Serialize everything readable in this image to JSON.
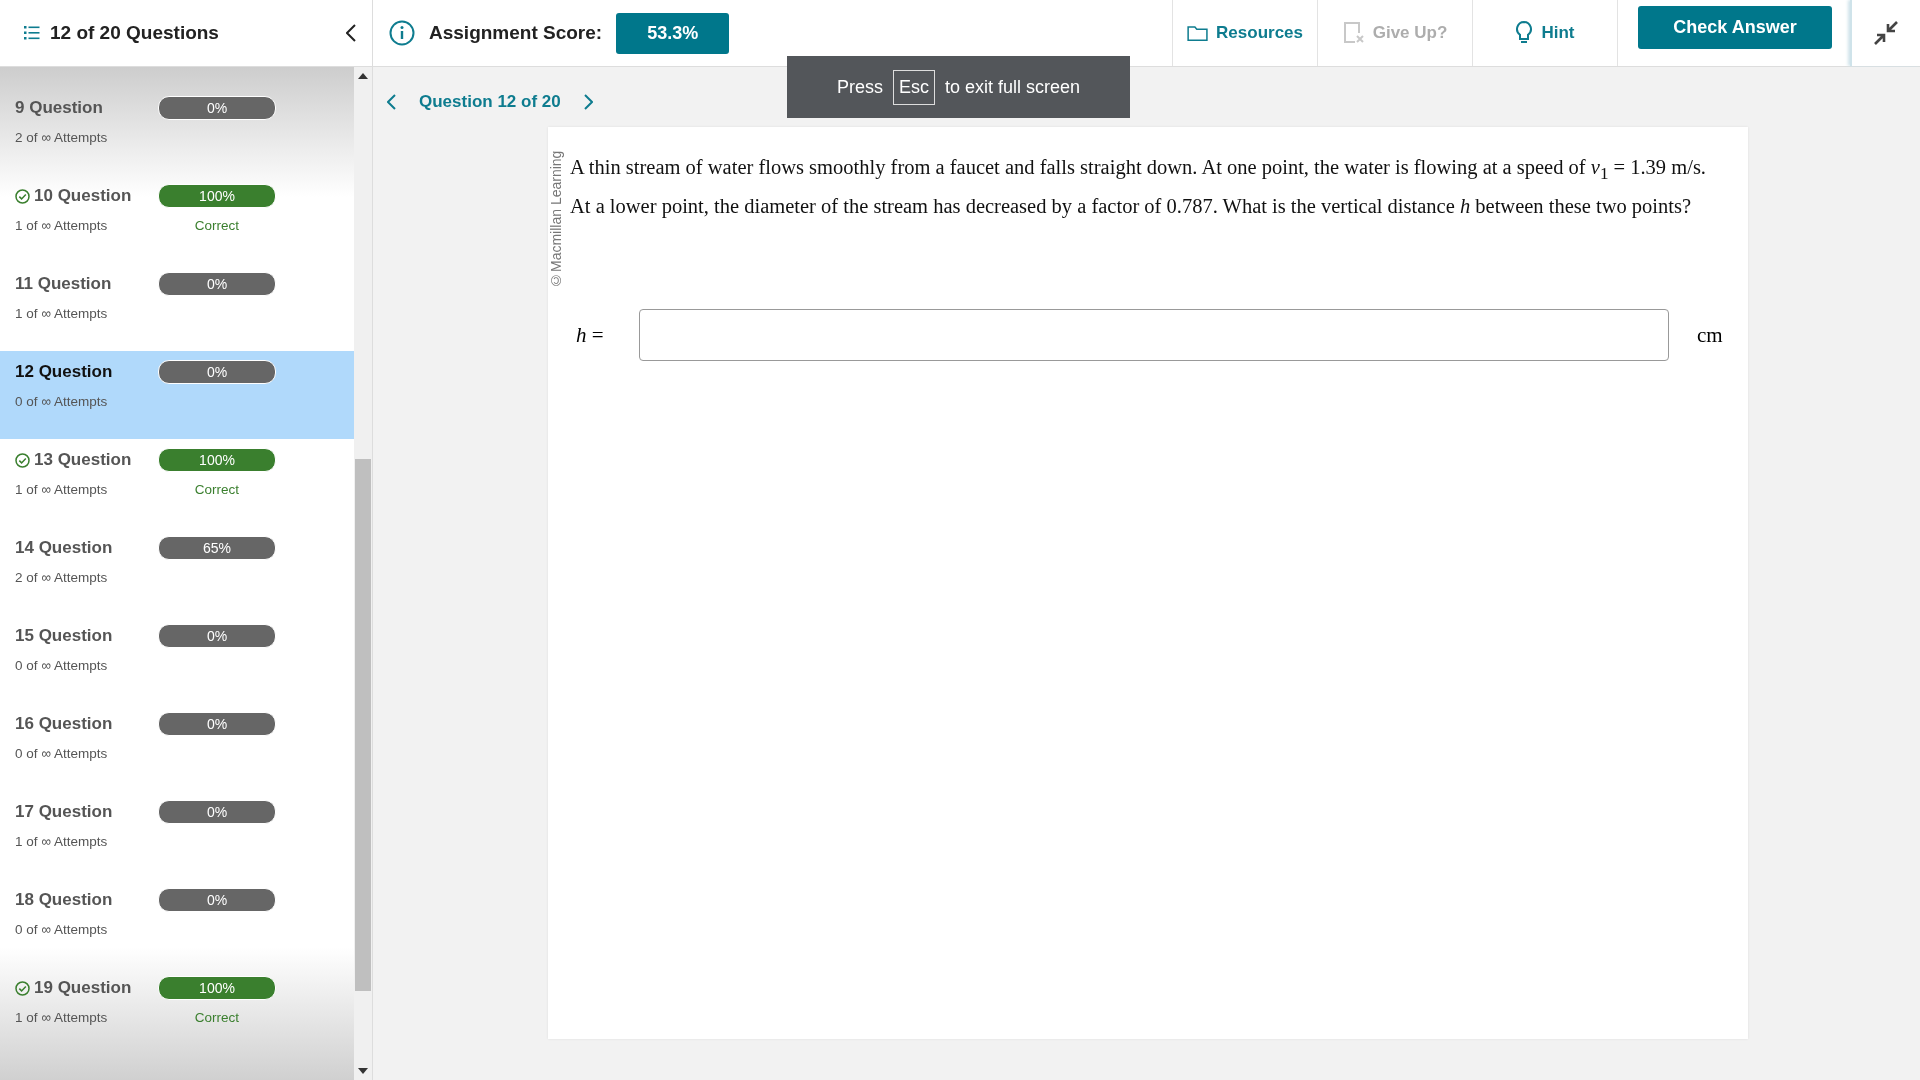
{
  "sidebar": {
    "title": "12 of 20 Questions",
    "items": [
      {
        "label": "9 Question",
        "attempts": "2 of ∞ Attempts",
        "score": "0%",
        "correct": false,
        "selected": false
      },
      {
        "label": "10 Question",
        "attempts": "1 of ∞ Attempts",
        "score": "100%",
        "correct": true,
        "result": "Correct",
        "selected": false
      },
      {
        "label": "11 Question",
        "attempts": "1 of ∞ Attempts",
        "score": "0%",
        "correct": false,
        "selected": false
      },
      {
        "label": "12 Question",
        "attempts": "0 of ∞ Attempts",
        "score": "0%",
        "correct": false,
        "selected": true
      },
      {
        "label": "13 Question",
        "attempts": "1 of ∞ Attempts",
        "score": "100%",
        "correct": true,
        "result": "Correct",
        "selected": false
      },
      {
        "label": "14 Question",
        "attempts": "2 of ∞ Attempts",
        "score": "65%",
        "correct": false,
        "selected": false
      },
      {
        "label": "15 Question",
        "attempts": "0 of ∞ Attempts",
        "score": "0%",
        "correct": false,
        "selected": false
      },
      {
        "label": "16 Question",
        "attempts": "0 of ∞ Attempts",
        "score": "0%",
        "correct": false,
        "selected": false
      },
      {
        "label": "17 Question",
        "attempts": "1 of ∞ Attempts",
        "score": "0%",
        "correct": false,
        "selected": false
      },
      {
        "label": "18 Question",
        "attempts": "0 of ∞ Attempts",
        "score": "0%",
        "correct": false,
        "selected": false
      },
      {
        "label": "19 Question",
        "attempts": "1 of ∞ Attempts",
        "score": "100%",
        "correct": true,
        "result": "Correct",
        "selected": false
      }
    ]
  },
  "toolbar": {
    "score_label": "Assignment Score:",
    "score": "53.3%",
    "resources": "Resources",
    "give_up": {
      "label": "Give Up?",
      "disabled": true
    },
    "hint": "Hint",
    "check": "Check Answer"
  },
  "toast": {
    "before": "Press",
    "key": "Esc",
    "after": "to exit full screen"
  },
  "navigation": {
    "label": "Question 12 of 20"
  },
  "question": {
    "copyright": "©Macmillan Learning",
    "text": "A thin stream of water flows smoothly from a faucet and falls straight down. At one point, the water is flowing at a speed of *v*$_{1}$ = 1.39 m/s. At a lower point, the diameter of the stream has decreased by a factor of 0.787. What is the vertical distance *h* between these two points?",
    "answer_label": "*h* =",
    "unit": "cm"
  }
}
